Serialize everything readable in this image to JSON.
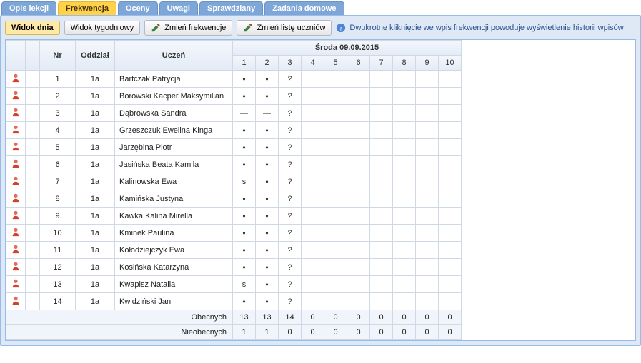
{
  "tabs": [
    "Opis lekcji",
    "Frekwencja",
    "Oceny",
    "Uwagi",
    "Sprawdziany",
    "Zadania domowe"
  ],
  "active_tab": 1,
  "toolbar": {
    "day_view": "Widok dnia",
    "week_view": "Widok tygodniowy",
    "change_attendance": "Zmień frekwencje",
    "change_students": "Zmień listę uczniów",
    "hint": "Dwukrotne kliknięcie we wpis frekwencji powoduje wyświetlenie historii wpisów"
  },
  "headers": {
    "nr": "Nr",
    "class": "Oddział",
    "student": "Uczeń",
    "date": "Środa 09.09.2015",
    "periods": [
      "1",
      "2",
      "3",
      "4",
      "5",
      "6",
      "7",
      "8",
      "9",
      "10"
    ]
  },
  "rows": [
    {
      "nr": "1",
      "class": "1a",
      "name": "Bartczak Patrycja",
      "att": [
        "dot",
        "dot",
        "?",
        "",
        "",
        "",
        "",
        "",
        "",
        ""
      ]
    },
    {
      "nr": "2",
      "class": "1a",
      "name": "Borowski Kacper Maksymilian",
      "att": [
        "dot",
        "dot",
        "?",
        "",
        "",
        "",
        "",
        "",
        "",
        ""
      ]
    },
    {
      "nr": "3",
      "class": "1a",
      "name": "Dąbrowska Sandra",
      "att": [
        "dash",
        "dash",
        "?",
        "",
        "",
        "",
        "",
        "",
        "",
        ""
      ]
    },
    {
      "nr": "4",
      "class": "1a",
      "name": "Grzeszczuk Ewelina Kinga",
      "att": [
        "dot",
        "dot",
        "?",
        "",
        "",
        "",
        "",
        "",
        "",
        ""
      ]
    },
    {
      "nr": "5",
      "class": "1a",
      "name": "Jarzębina Piotr",
      "att": [
        "dot",
        "dot",
        "?",
        "",
        "",
        "",
        "",
        "",
        "",
        ""
      ]
    },
    {
      "nr": "6",
      "class": "1a",
      "name": "Jasińska Beata Kamila",
      "att": [
        "dot",
        "dot",
        "?",
        "",
        "",
        "",
        "",
        "",
        "",
        ""
      ]
    },
    {
      "nr": "7",
      "class": "1a",
      "name": "Kalinowska Ewa",
      "att": [
        "s",
        "dot",
        "?",
        "",
        "",
        "",
        "",
        "",
        "",
        ""
      ]
    },
    {
      "nr": "8",
      "class": "1a",
      "name": "Kamińska Justyna",
      "att": [
        "dot",
        "dot",
        "?",
        "",
        "",
        "",
        "",
        "",
        "",
        ""
      ]
    },
    {
      "nr": "9",
      "class": "1a",
      "name": "Kawka Kalina Mirella",
      "att": [
        "dot",
        "dot",
        "?",
        "",
        "",
        "",
        "",
        "",
        "",
        ""
      ]
    },
    {
      "nr": "10",
      "class": "1a",
      "name": "Kminek Paulina",
      "att": [
        "dot",
        "dot",
        "?",
        "",
        "",
        "",
        "",
        "",
        "",
        ""
      ]
    },
    {
      "nr": "11",
      "class": "1a",
      "name": "Kołodziejczyk Ewa",
      "att": [
        "dot",
        "dot",
        "?",
        "",
        "",
        "",
        "",
        "",
        "",
        ""
      ]
    },
    {
      "nr": "12",
      "class": "1a",
      "name": "Kosińska Katarzyna",
      "att": [
        "dot",
        "dot",
        "?",
        "",
        "",
        "",
        "",
        "",
        "",
        ""
      ]
    },
    {
      "nr": "13",
      "class": "1a",
      "name": "Kwapisz Natalia",
      "att": [
        "s",
        "dot",
        "?",
        "",
        "",
        "",
        "",
        "",
        "",
        ""
      ]
    },
    {
      "nr": "14",
      "class": "1a",
      "name": "Kwidziński Jan",
      "att": [
        "dot",
        "dot",
        "?",
        "",
        "",
        "",
        "",
        "",
        "",
        ""
      ]
    }
  ],
  "totals": {
    "present_label": "Obecnych",
    "absent_label": "Nieobecnych",
    "present": [
      "13",
      "13",
      "14",
      "0",
      "0",
      "0",
      "0",
      "0",
      "0",
      "0"
    ],
    "absent": [
      "1",
      "1",
      "0",
      "0",
      "0",
      "0",
      "0",
      "0",
      "0",
      "0"
    ]
  }
}
